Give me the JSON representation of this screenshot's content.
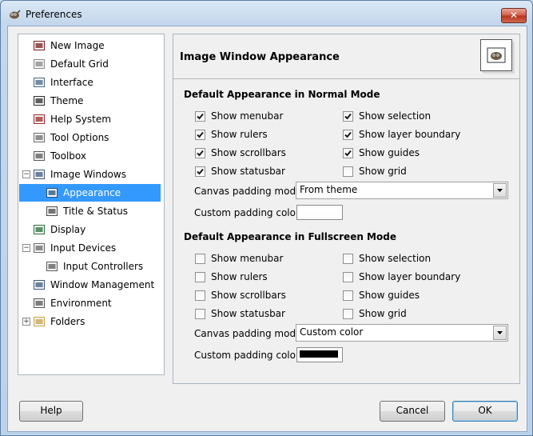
{
  "window": {
    "title": "Preferences",
    "close_label": "✕"
  },
  "sidebar": {
    "items": [
      {
        "label": "New Image",
        "icon": "new-image-icon"
      },
      {
        "label": "Default Grid",
        "icon": "grid-icon"
      },
      {
        "label": "Interface",
        "icon": "interface-icon"
      },
      {
        "label": "Theme",
        "icon": "theme-icon"
      },
      {
        "label": "Help System",
        "icon": "help-system-icon"
      },
      {
        "label": "Tool Options",
        "icon": "tool-options-icon"
      },
      {
        "label": "Toolbox",
        "icon": "toolbox-icon"
      },
      {
        "label": "Image Windows",
        "icon": "image-windows-icon",
        "expander": "−"
      },
      {
        "label": "Appearance",
        "icon": "appearance-icon",
        "selected": true
      },
      {
        "label": "Title & Status",
        "icon": "title-status-icon"
      },
      {
        "label": "Display",
        "icon": "display-icon"
      },
      {
        "label": "Input Devices",
        "icon": "input-devices-icon",
        "expander": "−"
      },
      {
        "label": "Input Controllers",
        "icon": "input-controllers-icon"
      },
      {
        "label": "Window Management",
        "icon": "window-management-icon"
      },
      {
        "label": "Environment",
        "icon": "environment-icon"
      },
      {
        "label": "Folders",
        "icon": "folders-icon",
        "expander": "+"
      }
    ]
  },
  "panel": {
    "title": "Image Window Appearance",
    "normal": {
      "heading": "Default Appearance in Normal Mode",
      "checkboxes": [
        {
          "label": "Show menubar",
          "checked": true
        },
        {
          "label": "Show selection",
          "checked": true
        },
        {
          "label": "Show rulers",
          "checked": true
        },
        {
          "label": "Show layer boundary",
          "checked": true
        },
        {
          "label": "Show scrollbars",
          "checked": true
        },
        {
          "label": "Show guides",
          "checked": true
        },
        {
          "label": "Show statusbar",
          "checked": true
        },
        {
          "label": "Show grid",
          "checked": false
        }
      ],
      "padding_mode_label": "Canvas padding mode:",
      "padding_mode_value": "From theme",
      "padding_color_label": "Custom padding color:",
      "padding_color": "#ffffff"
    },
    "fullscreen": {
      "heading": "Default Appearance in Fullscreen Mode",
      "checkboxes": [
        {
          "label": "Show menubar",
          "checked": false
        },
        {
          "label": "Show selection",
          "checked": false
        },
        {
          "label": "Show rulers",
          "checked": false
        },
        {
          "label": "Show layer boundary",
          "checked": false
        },
        {
          "label": "Show scrollbars",
          "checked": false
        },
        {
          "label": "Show guides",
          "checked": false
        },
        {
          "label": "Show statusbar",
          "checked": false
        },
        {
          "label": "Show grid",
          "checked": false
        }
      ],
      "padding_mode_label": "Canvas padding mode:",
      "padding_mode_value": "Custom color",
      "padding_color_label": "Custom padding color:",
      "padding_color": "#000000"
    }
  },
  "buttons": {
    "help": "Help",
    "cancel": "Cancel",
    "ok": "OK"
  },
  "colors": {
    "selection": "#3399ff",
    "check": "#1b1b1b"
  }
}
